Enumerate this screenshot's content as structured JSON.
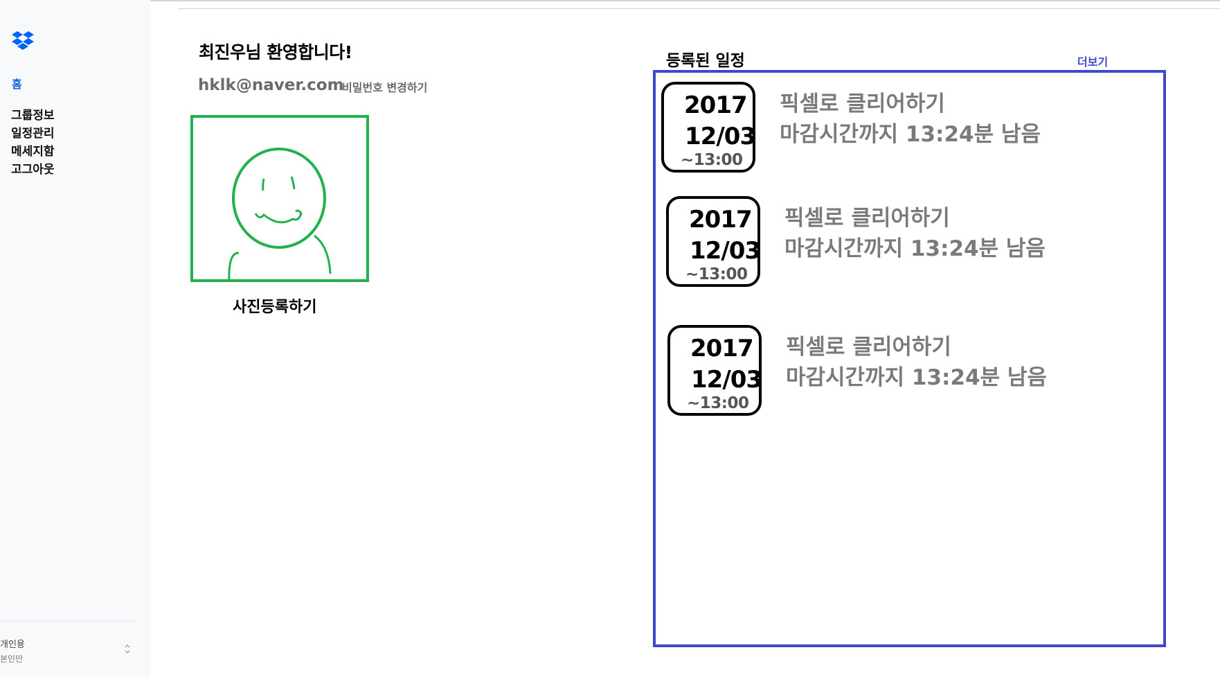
{
  "sidebar": {
    "logo_icon": "dropbox-logo-icon",
    "home_label": "홈",
    "items": [
      {
        "label": "그룹정보"
      },
      {
        "label": "일정관리"
      },
      {
        "label": "메세지함"
      },
      {
        "label": "고그아웃"
      }
    ],
    "account": {
      "name": "개인용",
      "subtitle": "본인만",
      "toggle_icon": "chevron-up-down-icon"
    }
  },
  "profile": {
    "welcome": "최진우님 환영합니다!",
    "email": "hklk@naver.com",
    "change_password": "비밀번호 변경하기",
    "photo_register": "사진등록하기",
    "avatar_icon": "smiley-avatar-icon",
    "avatar_color": "#22b14c"
  },
  "schedule": {
    "title": "등록된 일정",
    "more_label": "더보기",
    "box_color": "#3f48cc",
    "events": [
      {
        "year": "2017",
        "date": "12/03",
        "time": "~13:00",
        "title": "픽셀로 클리어하기",
        "remaining": "마감시간까지 13:24분 남음"
      },
      {
        "year": "2017",
        "date": "12/03",
        "time": "~13:00",
        "title": "픽셀로 클리어하기",
        "remaining": "마감시간까지 13:24분 남음"
      },
      {
        "year": "2017",
        "date": "12/03",
        "time": "~13:00",
        "title": "픽셀로 클리어하기",
        "remaining": "마감시간까지 13:24분 남음"
      }
    ]
  }
}
